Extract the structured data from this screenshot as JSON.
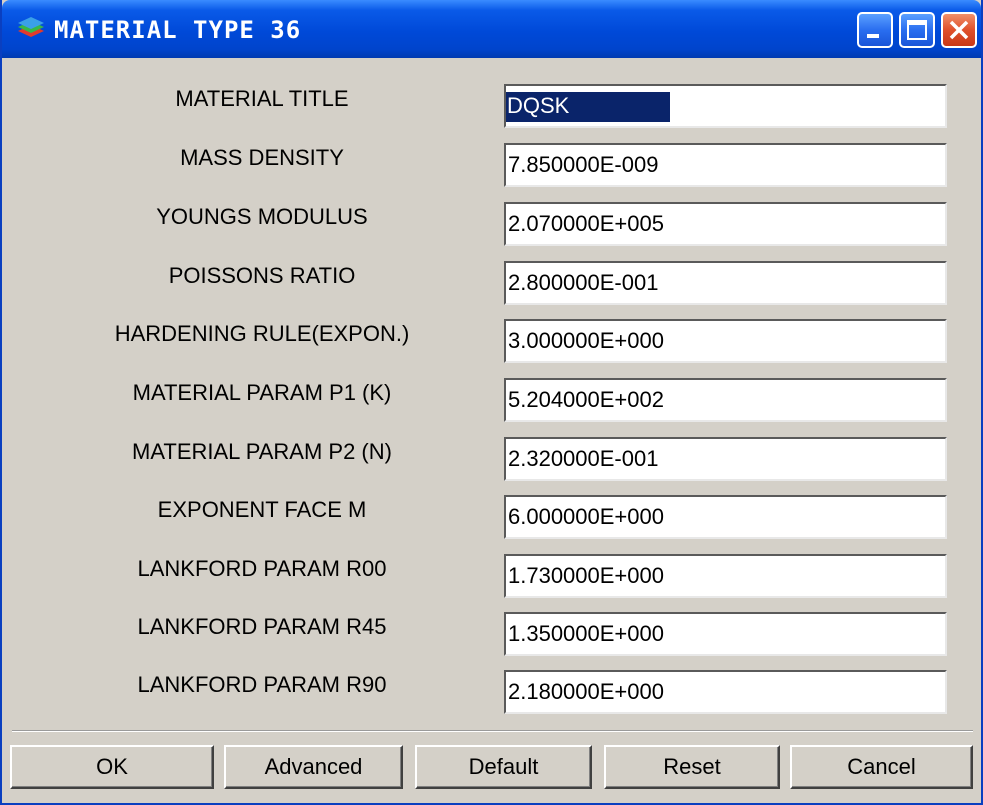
{
  "window": {
    "title": "MATERIAL TYPE 36"
  },
  "fields": [
    {
      "label": "MATERIAL TITLE",
      "value": "DQSK"
    },
    {
      "label": "MASS DENSITY",
      "value": "7.850000E-009"
    },
    {
      "label": "YOUNGS MODULUS",
      "value": "2.070000E+005"
    },
    {
      "label": "POISSONS RATIO",
      "value": "2.800000E-001"
    },
    {
      "label": "HARDENING RULE(EXPON.)",
      "value": "3.000000E+000"
    },
    {
      "label": "MATERIAL PARAM P1 (K)",
      "value": "5.204000E+002"
    },
    {
      "label": "MATERIAL PARAM P2 (N)",
      "value": "2.320000E-001"
    },
    {
      "label": "EXPONENT FACE M",
      "value": "6.000000E+000"
    },
    {
      "label": "LANKFORD PARAM R00",
      "value": "1.730000E+000"
    },
    {
      "label": "LANKFORD PARAM R45",
      "value": "1.350000E+000"
    },
    {
      "label": "LANKFORD PARAM R90",
      "value": "2.180000E+000"
    }
  ],
  "buttons": {
    "ok": "OK",
    "advanced": "Advanced",
    "default": "Default",
    "reset": "Reset",
    "cancel": "Cancel"
  },
  "colors": {
    "title_bar": "#0049d8",
    "dialog_bg": "#d4d0c8",
    "selection": "#0a246a",
    "close_button": "#e0502a"
  },
  "icons": {
    "app": "layered-material-icon",
    "minimize": "minimize-icon",
    "maximize": "maximize-icon",
    "close": "close-icon"
  }
}
